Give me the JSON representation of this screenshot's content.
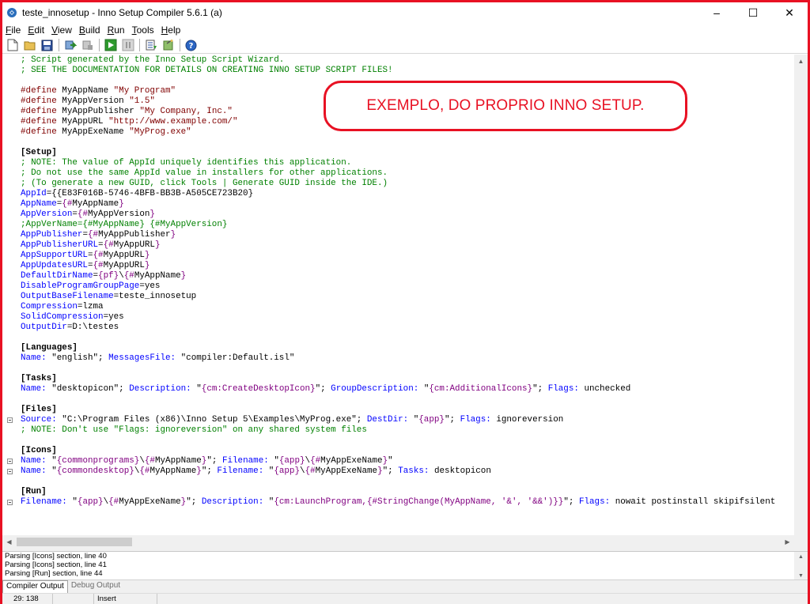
{
  "window": {
    "title": "teste_innosetup - Inno Setup Compiler 5.6.1 (a)",
    "icon": "inno-setup-icon",
    "minimize_glyph": "–",
    "maximize_glyph": "☐",
    "close_glyph": "✕"
  },
  "menu": {
    "items": [
      {
        "first": "F",
        "rest": "ile"
      },
      {
        "first": "E",
        "rest": "dit"
      },
      {
        "first": "V",
        "rest": "iew"
      },
      {
        "first": "B",
        "rest": "uild"
      },
      {
        "first": "R",
        "rest": "un"
      },
      {
        "first": "T",
        "rest": "ools"
      },
      {
        "first": "H",
        "rest": "elp"
      }
    ]
  },
  "toolbar": {
    "buttons": [
      "new-file-icon",
      "open-folder-icon",
      "save-icon",
      "compile-icon",
      "stop-compile-icon",
      "run-icon",
      "pause-icon",
      "target-icon",
      "wizard-icon",
      "help-icon"
    ]
  },
  "colors": {
    "comment": "#008000",
    "preprocessor": "#800000",
    "keyword": "#0000ff",
    "constant": "#800080",
    "annotation": "#e81123"
  },
  "editor": {
    "lines": [
      [
        [
          "c",
          "; Script generated by the Inno Setup Script Wizard."
        ]
      ],
      [
        [
          "c",
          "; SEE THE DOCUMENTATION FOR DETAILS ON CREATING INNO SETUP SCRIPT FILES!"
        ]
      ],
      [],
      [
        [
          "p",
          "#define"
        ],
        [
          "t",
          " MyAppName "
        ],
        [
          "p",
          "\"My Program\""
        ]
      ],
      [
        [
          "p",
          "#define"
        ],
        [
          "t",
          " MyAppVersion "
        ],
        [
          "p",
          "\"1.5\""
        ]
      ],
      [
        [
          "p",
          "#define"
        ],
        [
          "t",
          " MyAppPublisher "
        ],
        [
          "p",
          "\"My Company, Inc.\""
        ]
      ],
      [
        [
          "p",
          "#define"
        ],
        [
          "t",
          " MyAppURL "
        ],
        [
          "p",
          "\"http://www.example.com/\""
        ]
      ],
      [
        [
          "p",
          "#define"
        ],
        [
          "t",
          " MyAppExeName "
        ],
        [
          "p",
          "\"MyProg.exe\""
        ]
      ],
      [],
      [
        [
          "s",
          "[Setup]"
        ]
      ],
      [
        [
          "c",
          "; NOTE: The value of AppId uniquely identifies this application."
        ]
      ],
      [
        [
          "c",
          "; Do not use the same AppId value in installers for other applications."
        ]
      ],
      [
        [
          "c",
          "; (To generate a new GUID, click Tools | Generate GUID inside the IDE.)"
        ]
      ],
      [
        [
          "k",
          "AppId"
        ],
        [
          "t",
          "={{E83F016B-5746-4BFB-BB3B-A505CE723B20}"
        ]
      ],
      [
        [
          "k",
          "AppName"
        ],
        [
          "t",
          "="
        ],
        [
          "v",
          "{#"
        ],
        [
          "t",
          "MyAppName"
        ],
        [
          "v",
          "}"
        ]
      ],
      [
        [
          "k",
          "AppVersion"
        ],
        [
          "t",
          "="
        ],
        [
          "v",
          "{#"
        ],
        [
          "t",
          "MyAppVersion"
        ],
        [
          "v",
          "}"
        ]
      ],
      [
        [
          "c",
          ";AppVerName={#MyAppName} {#MyAppVersion}"
        ]
      ],
      [
        [
          "k",
          "AppPublisher"
        ],
        [
          "t",
          "="
        ],
        [
          "v",
          "{#"
        ],
        [
          "t",
          "MyAppPublisher"
        ],
        [
          "v",
          "}"
        ]
      ],
      [
        [
          "k",
          "AppPublisherURL"
        ],
        [
          "t",
          "="
        ],
        [
          "v",
          "{#"
        ],
        [
          "t",
          "MyAppURL"
        ],
        [
          "v",
          "}"
        ]
      ],
      [
        [
          "k",
          "AppSupportURL"
        ],
        [
          "t",
          "="
        ],
        [
          "v",
          "{#"
        ],
        [
          "t",
          "MyAppURL"
        ],
        [
          "v",
          "}"
        ]
      ],
      [
        [
          "k",
          "AppUpdatesURL"
        ],
        [
          "t",
          "="
        ],
        [
          "v",
          "{#"
        ],
        [
          "t",
          "MyAppURL"
        ],
        [
          "v",
          "}"
        ]
      ],
      [
        [
          "k",
          "DefaultDirName"
        ],
        [
          "t",
          "="
        ],
        [
          "v",
          "{pf}"
        ],
        [
          "t",
          "\\"
        ],
        [
          "v",
          "{#"
        ],
        [
          "t",
          "MyAppName"
        ],
        [
          "v",
          "}"
        ]
      ],
      [
        [
          "k",
          "DisableProgramGroupPage"
        ],
        [
          "t",
          "=yes"
        ]
      ],
      [
        [
          "k",
          "OutputBaseFilename"
        ],
        [
          "t",
          "=teste_innosetup"
        ]
      ],
      [
        [
          "k",
          "Compression"
        ],
        [
          "t",
          "=lzma"
        ]
      ],
      [
        [
          "k",
          "SolidCompression"
        ],
        [
          "t",
          "=yes"
        ]
      ],
      [
        [
          "k",
          "OutputDir"
        ],
        [
          "t",
          "=D:\\testes"
        ]
      ],
      [],
      [
        [
          "s",
          "[Languages]"
        ]
      ],
      [
        [
          "k",
          "Name:"
        ],
        [
          "t",
          " \"english\"; "
        ],
        [
          "k",
          "MessagesFile:"
        ],
        [
          "t",
          " \"compiler:Default.isl\""
        ]
      ],
      [],
      [
        [
          "s",
          "[Tasks]"
        ]
      ],
      [
        [
          "k",
          "Name:"
        ],
        [
          "t",
          " \"desktopicon\"; "
        ],
        [
          "k",
          "Description:"
        ],
        [
          "t",
          " \""
        ],
        [
          "v",
          "{cm:CreateDesktopIcon}"
        ],
        [
          "t",
          "\"; "
        ],
        [
          "k",
          "GroupDescription:"
        ],
        [
          "t",
          " \""
        ],
        [
          "v",
          "{cm:AdditionalIcons}"
        ],
        [
          "t",
          "\"; "
        ],
        [
          "k",
          "Flags:"
        ],
        [
          "t",
          " unchecked"
        ]
      ],
      [],
      [
        [
          "s",
          "[Files]"
        ]
      ],
      [
        [
          "k",
          "Source:"
        ],
        [
          "t",
          " \"C:\\Program Files (x86)\\Inno Setup 5\\Examples\\MyProg.exe\"; "
        ],
        [
          "k",
          "DestDir:"
        ],
        [
          "t",
          " \""
        ],
        [
          "v",
          "{app}"
        ],
        [
          "t",
          "\"; "
        ],
        [
          "k",
          "Flags:"
        ],
        [
          "t",
          " ignoreversion"
        ]
      ],
      [
        [
          "c",
          "; NOTE: Don't use \"Flags: ignoreversion\" on any shared system files"
        ]
      ],
      [],
      [
        [
          "s",
          "[Icons]"
        ]
      ],
      [
        [
          "k",
          "Name:"
        ],
        [
          "t",
          " \""
        ],
        [
          "v",
          "{commonprograms}"
        ],
        [
          "t",
          "\\"
        ],
        [
          "v",
          "{#"
        ],
        [
          "t",
          "MyAppName"
        ],
        [
          "v",
          "}"
        ],
        [
          "t",
          "\"; "
        ],
        [
          "k",
          "Filename:"
        ],
        [
          "t",
          " \""
        ],
        [
          "v",
          "{app}"
        ],
        [
          "t",
          "\\"
        ],
        [
          "v",
          "{#"
        ],
        [
          "t",
          "MyAppExeName"
        ],
        [
          "v",
          "}"
        ],
        [
          "t",
          "\""
        ]
      ],
      [
        [
          "k",
          "Name:"
        ],
        [
          "t",
          " \""
        ],
        [
          "v",
          "{commondesktop}"
        ],
        [
          "t",
          "\\"
        ],
        [
          "v",
          "{#"
        ],
        [
          "t",
          "MyAppName"
        ],
        [
          "v",
          "}"
        ],
        [
          "t",
          "\"; "
        ],
        [
          "k",
          "Filename:"
        ],
        [
          "t",
          " \""
        ],
        [
          "v",
          "{app}"
        ],
        [
          "t",
          "\\"
        ],
        [
          "v",
          "{#"
        ],
        [
          "t",
          "MyAppExeName"
        ],
        [
          "v",
          "}"
        ],
        [
          "t",
          "\"; "
        ],
        [
          "k",
          "Tasks:"
        ],
        [
          "t",
          " desktopicon"
        ]
      ],
      [],
      [
        [
          "s",
          "[Run]"
        ]
      ],
      [
        [
          "k",
          "Filename:"
        ],
        [
          "t",
          " \""
        ],
        [
          "v",
          "{app}"
        ],
        [
          "t",
          "\\"
        ],
        [
          "v",
          "{#"
        ],
        [
          "t",
          "MyAppExeName"
        ],
        [
          "v",
          "}"
        ],
        [
          "t",
          "\"; "
        ],
        [
          "k",
          "Description:"
        ],
        [
          "t",
          " \""
        ],
        [
          "v",
          "{cm:LaunchProgram,{#StringChange(MyAppName, '&', '&&')}}"
        ],
        [
          "t",
          "\"; "
        ],
        [
          "k",
          "Flags:"
        ],
        [
          "t",
          " nowait postinstall skipifsilent"
        ]
      ]
    ],
    "fold_markers": [
      35,
      39,
      40,
      43
    ]
  },
  "annotation": {
    "text": "EXEMPLO,  DO PROPRIO INNO SETUP."
  },
  "output": {
    "lines": [
      "Parsing [Icons] section, line 40",
      "Parsing [Icons] section, line 41",
      "Parsing [Run] section, line 44"
    ]
  },
  "tabs": {
    "compiler_output": "Compiler Output",
    "debug_output": "Debug Output"
  },
  "status": {
    "position": "29: 138",
    "modified": "",
    "mode": "Insert"
  }
}
